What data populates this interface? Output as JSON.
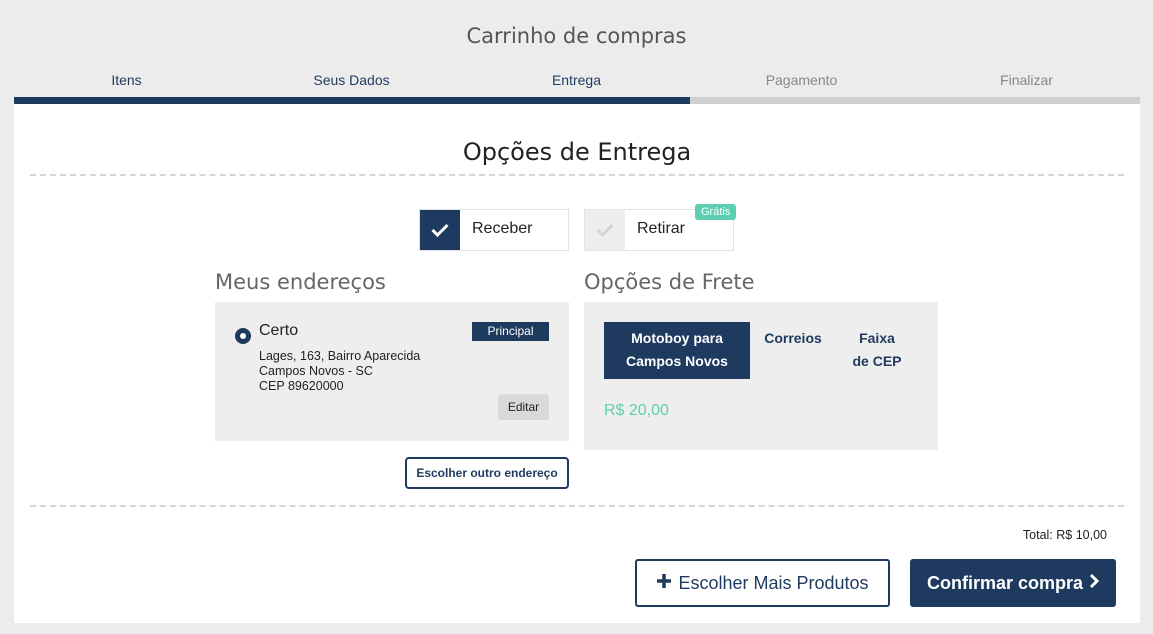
{
  "header": {
    "title": "Carrinho de compras"
  },
  "steps": [
    {
      "label": "Itens",
      "state": "done"
    },
    {
      "label": "Seus Dados",
      "state": "done"
    },
    {
      "label": "Entrega",
      "state": "current"
    },
    {
      "label": "Pagamento",
      "state": "todo"
    },
    {
      "label": "Finalizar",
      "state": "todo"
    }
  ],
  "progress": {
    "completed_fraction": 0.6
  },
  "delivery": {
    "title": "Opções de Entrega",
    "receive_label": "Receber",
    "pickup_label": "Retirar",
    "pickup_badge": "Grátis",
    "selected": "Receber"
  },
  "addresses": {
    "title": "Meus endereços",
    "items": [
      {
        "name": "Certo",
        "badge": "Principal",
        "street": "Lages, 163, Bairro Aparecida",
        "city": "Campos Novos - SC",
        "cep": "CEP 89620000",
        "edit_label": "Editar",
        "selected": true
      }
    ],
    "other_label": "Escolher outro endereço"
  },
  "shipping": {
    "title": "Opções de Frete",
    "options": [
      {
        "line1": "Motoboy para",
        "line2": "Campos Novos",
        "active": true
      },
      {
        "line1": "Correios",
        "line2": "",
        "active": false
      },
      {
        "line1": "Faixa",
        "line2": "de CEP",
        "active": false
      }
    ],
    "price": "R$ 20,00"
  },
  "footer": {
    "total": "Total: R$ 10,00",
    "more_label": "Escolher Mais Produtos",
    "confirm_label": "Confirmar compra"
  },
  "colors": {
    "primary": "#1e3a5f",
    "accent": "#5ccfb0",
    "background": "#ececec"
  },
  "icons": [
    "check-icon",
    "plus-icon",
    "chevron-right-icon",
    "radio-selected-icon"
  ]
}
